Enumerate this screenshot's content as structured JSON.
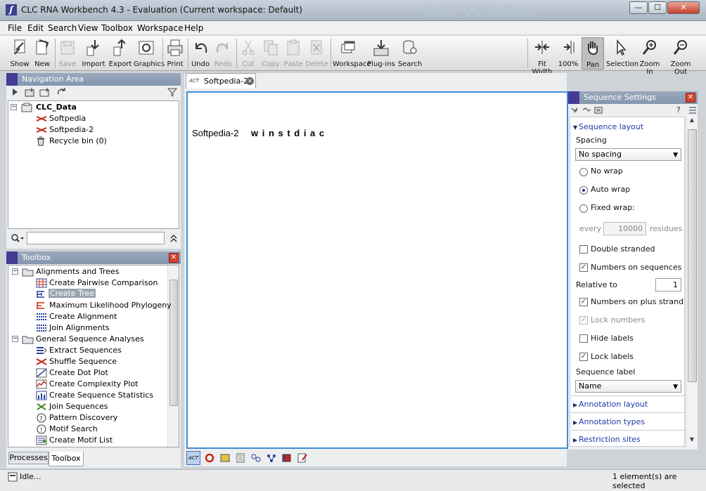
{
  "window": {
    "title": "CLC RNA Workbench 4.3 - Evaluation  (Current workspace: Default)",
    "watermark": "SOFTPEDIA",
    "minimize": "—",
    "maximize": "☐",
    "close": "✕"
  },
  "menu": [
    "File",
    "Edit",
    "Search",
    "View",
    "Toolbox",
    "Workspace",
    "Help"
  ],
  "toolbar": {
    "show": "Show",
    "new": "New",
    "save": "Save",
    "import": "Import",
    "export": "Export",
    "graphics": "Graphics",
    "print": "Print",
    "undo": "Undo",
    "redo": "Redo",
    "cut": "Cut",
    "copy": "Copy",
    "paste": "Paste",
    "delete": "Delete",
    "workspace": "Workspace",
    "plugins": "Plug-ins",
    "search": "Search",
    "fit_width": "Fit Width",
    "zoom100": "100%",
    "pan": "Pan",
    "selection": "Selection",
    "zoom_in": "Zoom In",
    "zoom_out": "Zoom Out"
  },
  "navigation": {
    "header": "Navigation Area",
    "root": "CLC_Data",
    "items": [
      "Softpedia",
      "Softpedia-2",
      "Recycle bin (0)"
    ],
    "search_placeholder": ""
  },
  "toolbox": {
    "header": "Toolbox",
    "groups": [
      {
        "label": "Alignments and Trees",
        "items": [
          "Create Pairwise Comparison",
          "Create Tree",
          "Maximum Likelihood Phylogeny",
          "Create Alignment",
          "Join Alignments"
        ]
      },
      {
        "label": "General Sequence Analyses",
        "items": [
          "Extract Sequences",
          "Shuffle Sequence",
          "Create Dot Plot",
          "Create Complexity Plot",
          "Create Sequence Statistics",
          "Join Sequences",
          "Pattern Discovery",
          "Motif Search",
          "Create Motif List"
        ]
      }
    ],
    "selected": "Create Tree",
    "tabs": [
      "Processes",
      "Toolbox"
    ]
  },
  "editor": {
    "tab_label": "Softpedia-2",
    "tab_badge": "ACT",
    "seq_name": "Softpedia-2",
    "sequence": "w i n s t d i a c"
  },
  "settings": {
    "header": "Sequence Settings",
    "help": "?",
    "section": "Sequence layout",
    "spacing_label": "Spacing",
    "spacing_value": "No spacing",
    "no_wrap": "No wrap",
    "auto_wrap": "Auto wrap",
    "fixed_wrap": "Fixed wrap:",
    "every": "every",
    "every_value": "10000",
    "residues": "residues",
    "double_stranded": "Double stranded",
    "numbers_on_sequences": "Numbers on sequences",
    "relative_to": "Relative to",
    "relative_value": "1",
    "numbers_on_plus": "Numbers on plus strand",
    "lock_numbers": "Lock numbers",
    "hide_labels": "Hide labels",
    "lock_labels": "Lock labels",
    "sequence_label": "Sequence label",
    "sequence_label_value": "Name",
    "annotation_layout": "Annotation layout",
    "annotation_types": "Annotation types",
    "restriction_sites": "Restriction sites",
    "checked": {
      "double_stranded": false,
      "numbers_on_sequences": true,
      "numbers_on_plus": true,
      "lock_numbers": true,
      "hide_labels": false,
      "lock_labels": true
    },
    "wrap_mode": "auto"
  },
  "status": {
    "left": "Idle...",
    "right": "1 element(s) are selected"
  },
  "colors": {
    "panel_header": "#8a9ab0",
    "accent_mark": "#473a95",
    "link": "#1e3aa8",
    "selection_border": "#3f8fd8"
  }
}
